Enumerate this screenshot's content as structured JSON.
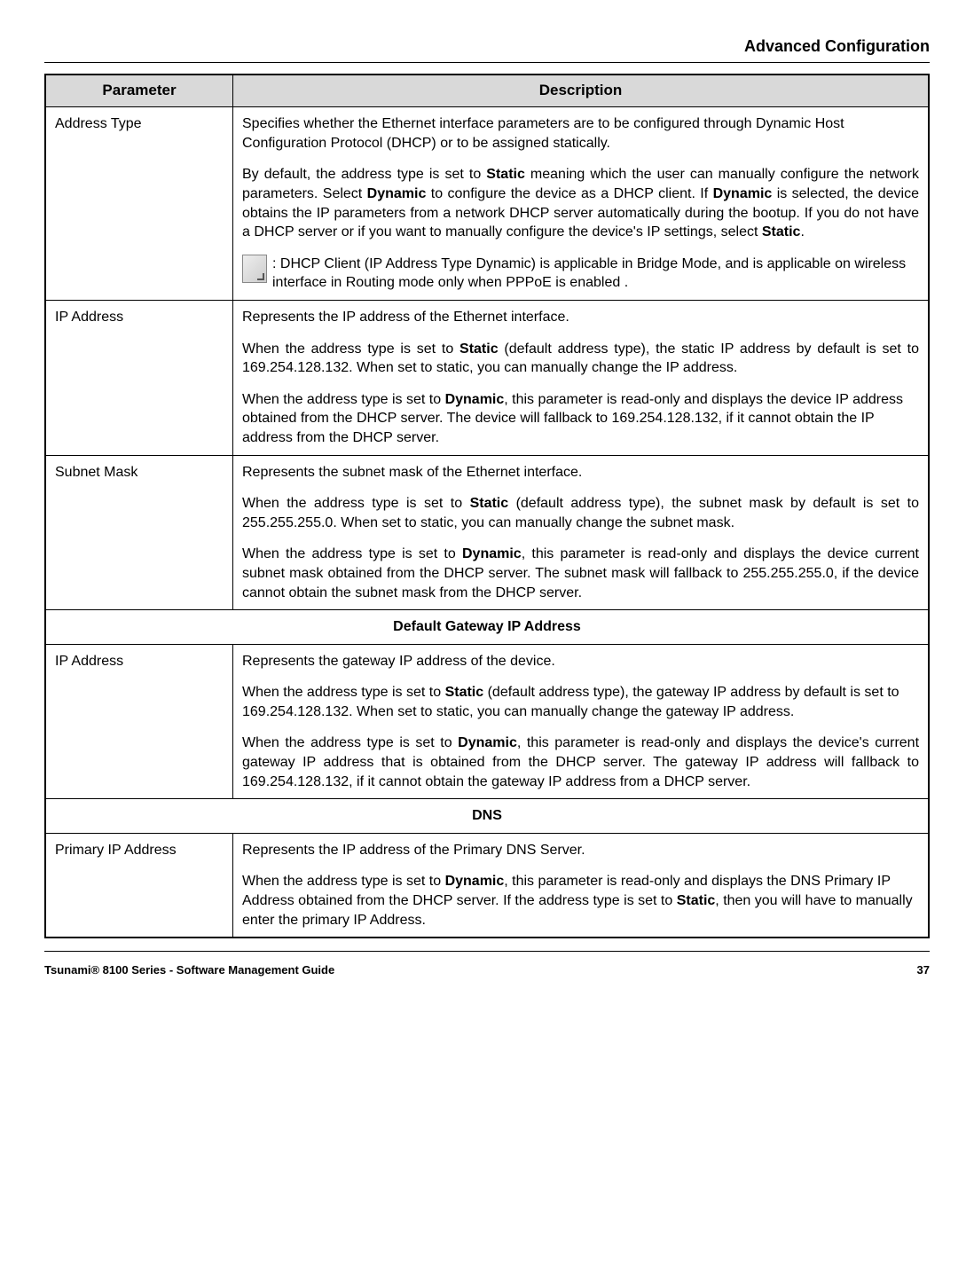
{
  "header": {
    "title": "Advanced Configuration"
  },
  "table": {
    "col1": "Parameter",
    "col2": "Description",
    "rows": {
      "addressType": {
        "param": "Address Type",
        "p1": "Specifies whether the Ethernet interface parameters are to be configured through Dynamic Host Configuration Protocol (DHCP) or to be assigned statically.",
        "p2a": "By default, the address type is set to ",
        "p2b": " meaning which the user can manually configure the network parameters. Select ",
        "p2c": " to configure the device as a DHCP client. If ",
        "p2d": " is selected, the device obtains the IP parameters from a network DHCP server automatically during the bootup. If you do not have a DHCP server or if you want to manually configure the device's IP settings, select ",
        "p2e": ".",
        "b1": "Static",
        "b2": "Dynamic",
        "b3": "Dynamic",
        "b4": "Static",
        "note": ": DHCP Client (IP Address Type Dynamic) is applicable in Bridge Mode, and is applicable on wireless interface in Routing mode only when PPPoE is enabled ."
      },
      "ipAddress": {
        "param": "IP Address",
        "p1": "Represents the IP address of the Ethernet interface.",
        "p2a": "When the address type is set to ",
        "p2b": " (default address type), the static IP address by default is set to 169.254.128.132. When set to static, you can manually change the IP address.",
        "b1": "Static",
        "p3a": "When the address type is set to ",
        "p3b": ", this parameter is read-only and displays the device IP address obtained from the DHCP server. The device will fallback to 169.254.128.132, if it cannot obtain the IP address from the DHCP server.",
        "b2": "Dynamic"
      },
      "subnet": {
        "param": "Subnet Mask",
        "p1": "Represents the subnet mask of the Ethernet interface.",
        "p2a": "When the address type is set to ",
        "p2b": " (default address type), the subnet mask by default is set to 255.255.255.0. When set to static, you can manually change the subnet mask.",
        "b1": "Static",
        "p3a": "When the address type is set to ",
        "p3b": ", this parameter is read-only and displays the device current subnet mask obtained from the DHCP server. The subnet mask will fallback to 255.255.255.0, if the device cannot obtain the subnet mask from the DHCP server.",
        "b2": "Dynamic"
      },
      "gatewayHeader": "Default Gateway IP Address",
      "gateway": {
        "param": "IP Address",
        "p1": "Represents the gateway IP address of the device.",
        "p2a": "When the address type is set to ",
        "p2b": " (default address type), the gateway IP address by default is set to 169.254.128.132. When set to static, you can manually change the gateway IP address.",
        "b1": "Static",
        "p3a": "When the address type is set to ",
        "p3b": ", this parameter is read-only and displays the device's current gateway IP address that is obtained from the DHCP server. The gateway IP address will fallback to 169.254.128.132, if it cannot obtain the gateway IP address from a DHCP server.",
        "b2": "Dynamic"
      },
      "dnsHeader": "DNS",
      "dns": {
        "param": "Primary IP Address",
        "p1": "Represents the IP address of the Primary DNS Server.",
        "p2a": "When the address type is set to ",
        "p2b": ", this parameter is read-only and displays the DNS Primary IP Address obtained from the DHCP server. If the address type is set to ",
        "p2c": ", then you will have to manually enter the primary IP Address.",
        "b1": "Dynamic",
        "b2": "Static"
      }
    }
  },
  "footer": {
    "left": "Tsunami® 8100 Series - Software Management Guide",
    "right": "37"
  }
}
